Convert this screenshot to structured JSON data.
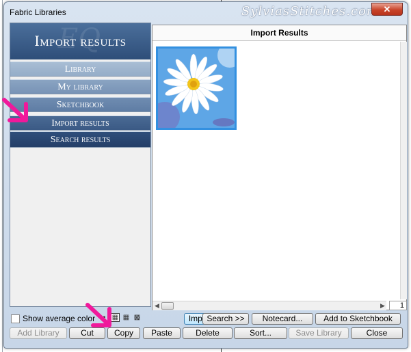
{
  "window": {
    "title": "Fabric Libraries",
    "watermark": "SylviasStitches.com",
    "close_label": "✕"
  },
  "left_panel": {
    "header_title": "Import results",
    "header_logo": "EQ",
    "nav_items": [
      {
        "label": "Library"
      },
      {
        "label": "My library"
      },
      {
        "label": "Sketchbook"
      },
      {
        "label": "Import results"
      },
      {
        "label": "Search results"
      }
    ]
  },
  "right_panel": {
    "header": "Import Results",
    "page_number": "1"
  },
  "options": {
    "show_average_color_label": "Show average color",
    "show_average_color_checked": false,
    "swatch_size_icons": [
      "size-small-icon",
      "size-medium-icon",
      "size-large-icon",
      "size-xlarge-icon"
    ]
  },
  "buttons_row1": {
    "import": "Import     >>",
    "search": "Search     >>",
    "notecard": "Notecard...",
    "add_to_sketchbook": "Add to Sketchbook"
  },
  "buttons_row2": {
    "add_library": "Add Library",
    "cut": "Cut",
    "copy": "Copy",
    "paste": "Paste",
    "delete": "Delete",
    "sort": "Sort...",
    "save_library": "Save Library",
    "close": "Close"
  },
  "colors": {
    "accent_pink": "#f0199b",
    "panel_blue": "#2e4e79",
    "selection_blue": "#3390e0"
  }
}
